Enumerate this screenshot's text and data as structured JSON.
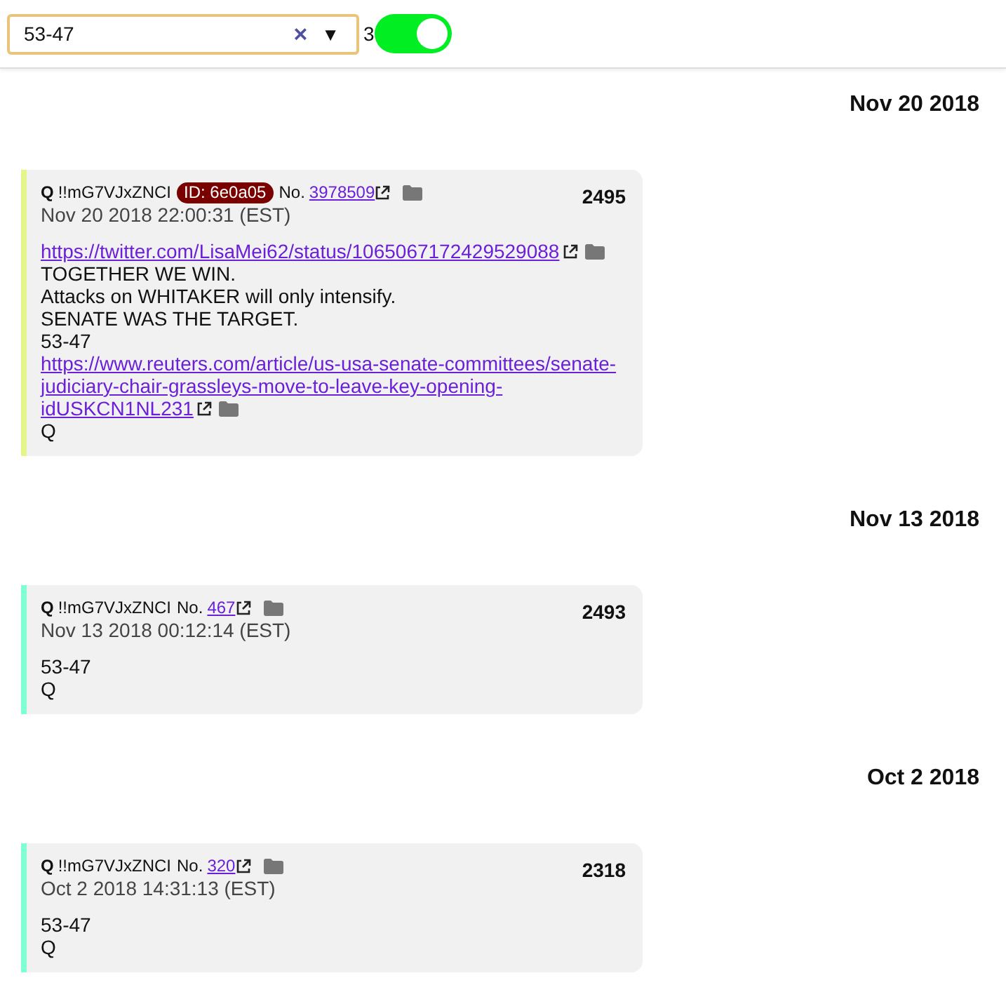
{
  "toolbar": {
    "search": {
      "value": "53-47",
      "clear": "×",
      "dropdown": "▼"
    },
    "count": "3",
    "switch": {
      "on": true
    }
  },
  "groups": [
    {
      "date": "Nov 20 2018",
      "post": {
        "name": "Q",
        "trip": "!!mG7VJxZNCI",
        "id": "ID: 6e0a05",
        "no_label": "No.",
        "no": "3978509",
        "timestamp": "Nov 20 2018 22:00:31 (EST)",
        "number": "2495",
        "color": "#e6f58a",
        "lines": [
          {
            "kind": "link",
            "text": "https://twitter.com/LisaMei62/status/1065067172429529088"
          },
          {
            "kind": "text",
            "text": "TOGETHER WE WIN."
          },
          {
            "kind": "text",
            "text": "Attacks on WHITAKER will only intensify."
          },
          {
            "kind": "text",
            "text": "SENATE WAS THE TARGET."
          },
          {
            "kind": "text",
            "text": "53-47"
          },
          {
            "kind": "link",
            "text": "https://www.reuters.com/article/us-usa-senate-committees/senate-judiciary-chair-grassleys-move-to-leave-key-opening-idUSKCN1NL231"
          },
          {
            "kind": "text",
            "text": "Q"
          }
        ]
      }
    },
    {
      "date": "Nov 13 2018",
      "post": {
        "name": "Q",
        "trip": "!!mG7VJxZNCI",
        "no_label": "No.",
        "no": "467",
        "timestamp": "Nov 13 2018 00:12:14 (EST)",
        "number": "2493",
        "color": "#7fffd4",
        "lines": [
          {
            "kind": "text",
            "text": "53-47"
          },
          {
            "kind": "text",
            "text": "Q"
          }
        ]
      }
    },
    {
      "date": "Oct 2 2018",
      "post": {
        "name": "Q",
        "trip": "!!mG7VJxZNCI",
        "no_label": "No.",
        "no": "320",
        "timestamp": "Oct 2 2018 14:31:13 (EST)",
        "number": "2318",
        "color": "#7fffd4",
        "lines": [
          {
            "kind": "text",
            "text": "53-47"
          },
          {
            "kind": "text",
            "text": "Q"
          }
        ]
      }
    }
  ]
}
